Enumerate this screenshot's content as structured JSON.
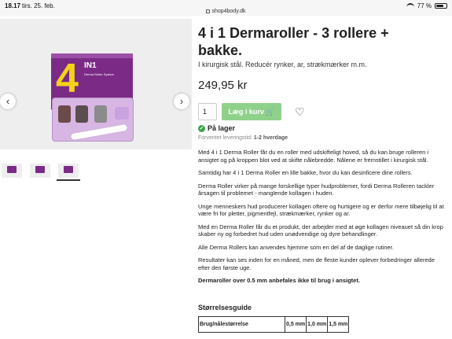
{
  "statusbar": {
    "time": "18.17",
    "date": "tirs. 25. feb.",
    "url": "shop4body.dk",
    "battery": "77 %",
    "battery_level": 0.77
  },
  "gallery": {
    "prev_label": "‹",
    "next_label": "›",
    "box_big": "4",
    "box_label": "IN1",
    "box_sub": "Derma Roller System"
  },
  "product": {
    "title": "4 i 1 Dermaroller - 3 rollere + bakke.",
    "subtitle": "I kirurgisk stål. Reducér rynker, ar, strækmærker m.m.",
    "price": "249,95 kr",
    "quantity": "1",
    "add_to_cart": "Læg i kurv",
    "stock": "På lager",
    "delivery_label": "Forventet leveringstid:",
    "delivery_value": "1-2 hverdage"
  },
  "description": [
    "Med 4 i 1 Derma Roller får du en roller med udskifteligt hoved, så du kan bruge rolleren i ansigtet og på kroppen blot ved at skifte nålebredde. Nålene er fremstillet i kirurgisk stål.",
    "Samtidig har 4 i 1 Derma Roller en lille bakke, hvor du kan desinficere dine rollers.",
    "Derma Roller virker på mange forskellige typer hudproblemer, fordi Derma Rolleren tackler årsagen til problemet - manglende kollagen i huden.",
    "Unge menneskers hud producerer kollagen oftere og hurtigere og er derfor mere tilbøjelig til at være fri for pletter, pigmentfejl, strækmærker, rynker og ar.",
    "Med en Derma Roller får du et produkt, der arbejder med at øge kollagen niveauet så din krop skaber ny og forbedret hud uden unødvendige og dyre behandlinger.",
    "Alle Derma Rollers kan anvendes hjemme som en del af de daglige rutiner.",
    "Resultater kan ses inden for en måned, men de fleste kunder oplever forbedringer allerede efter den første uge."
  ],
  "warning": "Dermaroller over 0.5 mm anbefales ikke til brug i ansigtet.",
  "size_guide": {
    "title": "Størrelsesguide",
    "headers": [
      "Brug/nålestørrelse",
      "0,5 mm",
      "1,0 mm",
      "1,5 mm"
    ]
  }
}
